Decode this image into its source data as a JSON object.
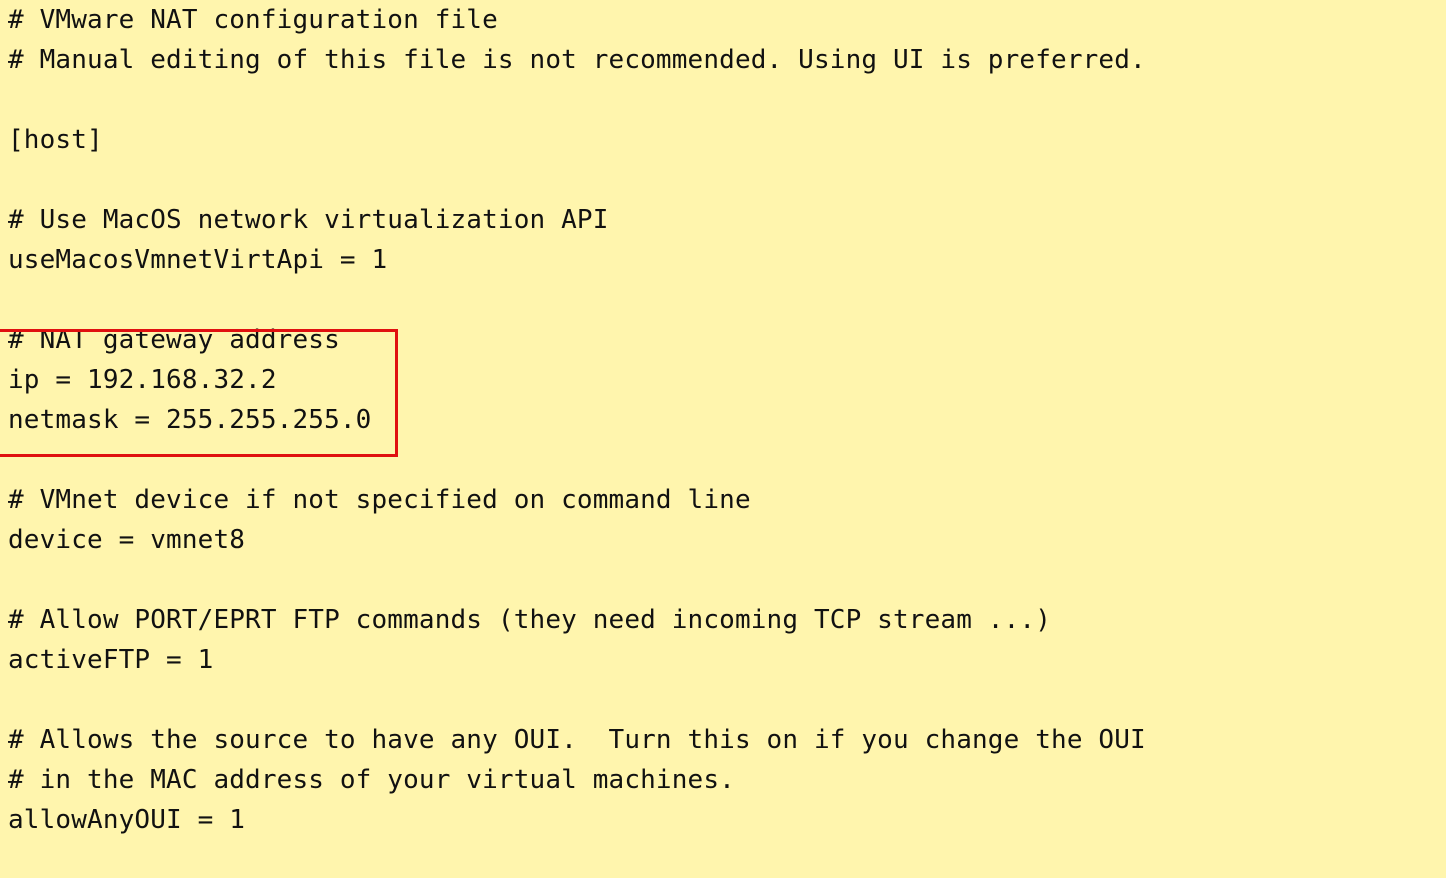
{
  "file": {
    "lines": [
      "# VMware NAT configuration file",
      "# Manual editing of this file is not recommended. Using UI is preferred.",
      "",
      "[host]",
      "",
      "# Use MacOS network virtualization API",
      "useMacosVmnetVirtApi = 1",
      "",
      "# NAT gateway address",
      "ip = 192.168.32.2",
      "netmask = 255.255.255.0",
      "",
      "# VMnet device if not specified on command line",
      "device = vmnet8",
      "",
      "# Allow PORT/EPRT FTP commands (they need incoming TCP stream ...)",
      "activeFTP = 1",
      "",
      "# Allows the source to have any OUI.  Turn this on if you change the OUI",
      "# in the MAC address of your virtual machines.",
      "allowAnyOUI = 1"
    ]
  },
  "colors": {
    "background": "#fff5ad",
    "text": "#111111",
    "highlight": "#e01010"
  }
}
